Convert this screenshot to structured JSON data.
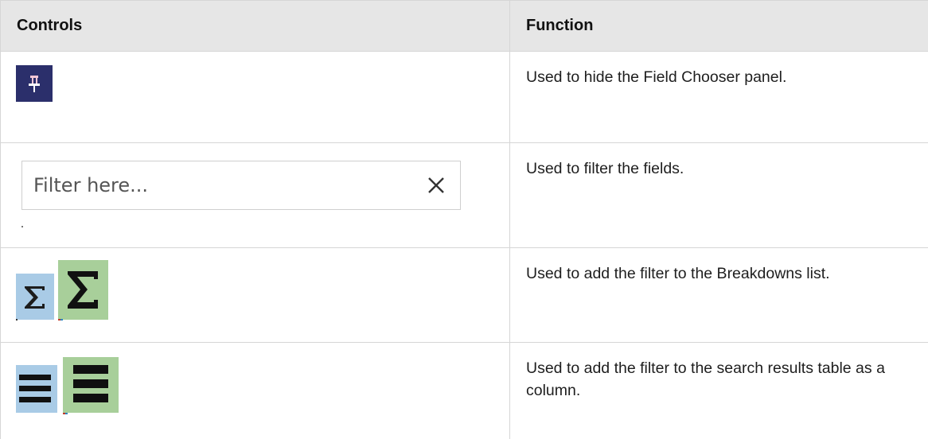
{
  "table": {
    "headers": {
      "controls": "Controls",
      "function": "Function"
    },
    "rows": [
      {
        "control": "pin-icon",
        "function": "Used to hide the Field Chooser panel."
      },
      {
        "control": "filter-input",
        "filter_placeholder": "Filter here...",
        "function": "Used to filter the fields."
      },
      {
        "control": "sigma-icons",
        "function": "Used to add the filter to the Breakdowns list."
      },
      {
        "control": "column-list-icons",
        "function": "Used to add the filter to the search results table as a column."
      }
    ]
  },
  "colors": {
    "pin_background": "#2b2f6b",
    "blue_tile": "#a9cbe6",
    "green_tile": "#a8cf9a",
    "header_background": "#e6e6e6"
  }
}
